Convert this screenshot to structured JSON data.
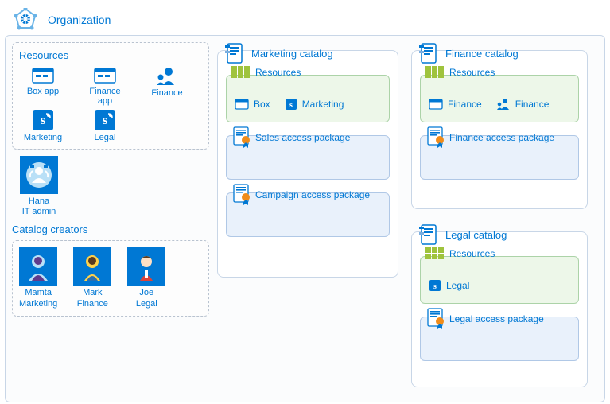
{
  "organization": {
    "title": "Organization"
  },
  "left": {
    "resources": {
      "title": "Resources",
      "items": [
        {
          "label": "Box app"
        },
        {
          "label": "Finance app"
        },
        {
          "label": "Finance"
        },
        {
          "label": "Marketing"
        },
        {
          "label": "Legal"
        }
      ]
    },
    "admin": {
      "name": "Hana",
      "role": "IT admin"
    },
    "catalog_creators": {
      "title": "Catalog creators",
      "people": [
        {
          "name": "Mamta",
          "role": "Marketing"
        },
        {
          "name": "Mark",
          "role": "Finance"
        },
        {
          "name": "Joe",
          "role": "Legal"
        }
      ]
    }
  },
  "catalogs": {
    "marketing": {
      "title": "Marketing catalog",
      "resources_title": "Resources",
      "resources": [
        {
          "label": "Box"
        },
        {
          "label": "Marketing"
        }
      ],
      "packages": [
        {
          "label": "Sales access package"
        },
        {
          "label": "Campaign access package"
        }
      ]
    },
    "finance": {
      "title": "Finance catalog",
      "resources_title": "Resources",
      "resources": [
        {
          "label": "Finance"
        },
        {
          "label": "Finance"
        }
      ],
      "packages": [
        {
          "label": "Finance access package"
        }
      ]
    },
    "legal": {
      "title": "Legal catalog",
      "resources_title": "Resources",
      "resources": [
        {
          "label": "Legal"
        }
      ],
      "packages": [
        {
          "label": "Legal access package"
        }
      ]
    }
  }
}
